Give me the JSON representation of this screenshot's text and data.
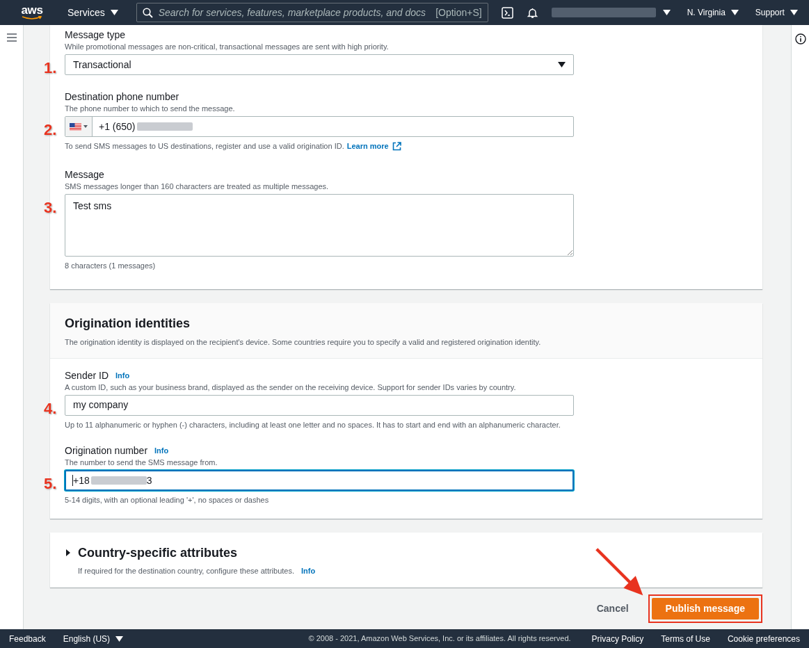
{
  "top_nav": {
    "logo": "aws",
    "services": "Services",
    "search_placeholder": "Search for services, features, marketplace products, and docs",
    "shortcut": "[Option+S]",
    "region": "N. Virginia",
    "support": "Support"
  },
  "message_details": {
    "fields": [
      {
        "kind": "select",
        "step": "1.",
        "label": "Message type",
        "description": "While promotional messages are non-critical, transactional messages are sent with high priority.",
        "value": "Transactional",
        "focused": false
      },
      {
        "kind": "phone",
        "step": "2.",
        "label": "Destination phone number",
        "description": "The phone number to which to send the message.",
        "value": "+1 (650)",
        "redacted": true,
        "focused": false,
        "hint": "To send SMS messages to US destinations, register and use a valid origination ID.",
        "link": "Learn more"
      },
      {
        "kind": "textarea",
        "step": "3.",
        "label": "Message",
        "description": "SMS messages longer than 160 characters are treated as multiple messages.",
        "value": "Test sms",
        "focused": false,
        "hint": "8 characters (1 messages)"
      }
    ]
  },
  "origination_identities": {
    "title": "Origination identities",
    "description": "The origination identity is displayed on the recipient's device. Some countries require you to specify a valid and registered origination identity.",
    "fields": [
      {
        "kind": "text",
        "step": "4.",
        "label": "Sender ID",
        "info": "Info",
        "description": "A custom ID, such as your business brand, displayed as the sender on the receiving device. Support for sender IDs varies by country.",
        "value": "my company",
        "focused": false,
        "hint": "Up to 11 alphanumeric or hyphen (-) characters, including at least one letter and no spaces. It has to start and end with an alphanumeric character."
      },
      {
        "kind": "text",
        "step": "5.",
        "label": "Origination number",
        "info": "Info",
        "description": "The number to send the SMS message from.",
        "value": "+18",
        "value_end": "3",
        "redacted": true,
        "focused": true,
        "hint": "5-14 digits, with an optional leading '+', no spaces or dashes"
      }
    ]
  },
  "country_attributes": {
    "title": "Country-specific attributes",
    "expanded": false,
    "description": "If required for the destination country, configure these attributes.",
    "info": "Info"
  },
  "actions": {
    "cancel": "Cancel",
    "publish": "Publish message"
  },
  "footer": {
    "feedback": "Feedback",
    "language": "English (US)",
    "copyright": "© 2008 - 2021, Amazon Web Services, Inc. or its affiliates. All rights reserved.",
    "links": [
      "Privacy Policy",
      "Terms of Use",
      "Cookie preferences"
    ]
  }
}
